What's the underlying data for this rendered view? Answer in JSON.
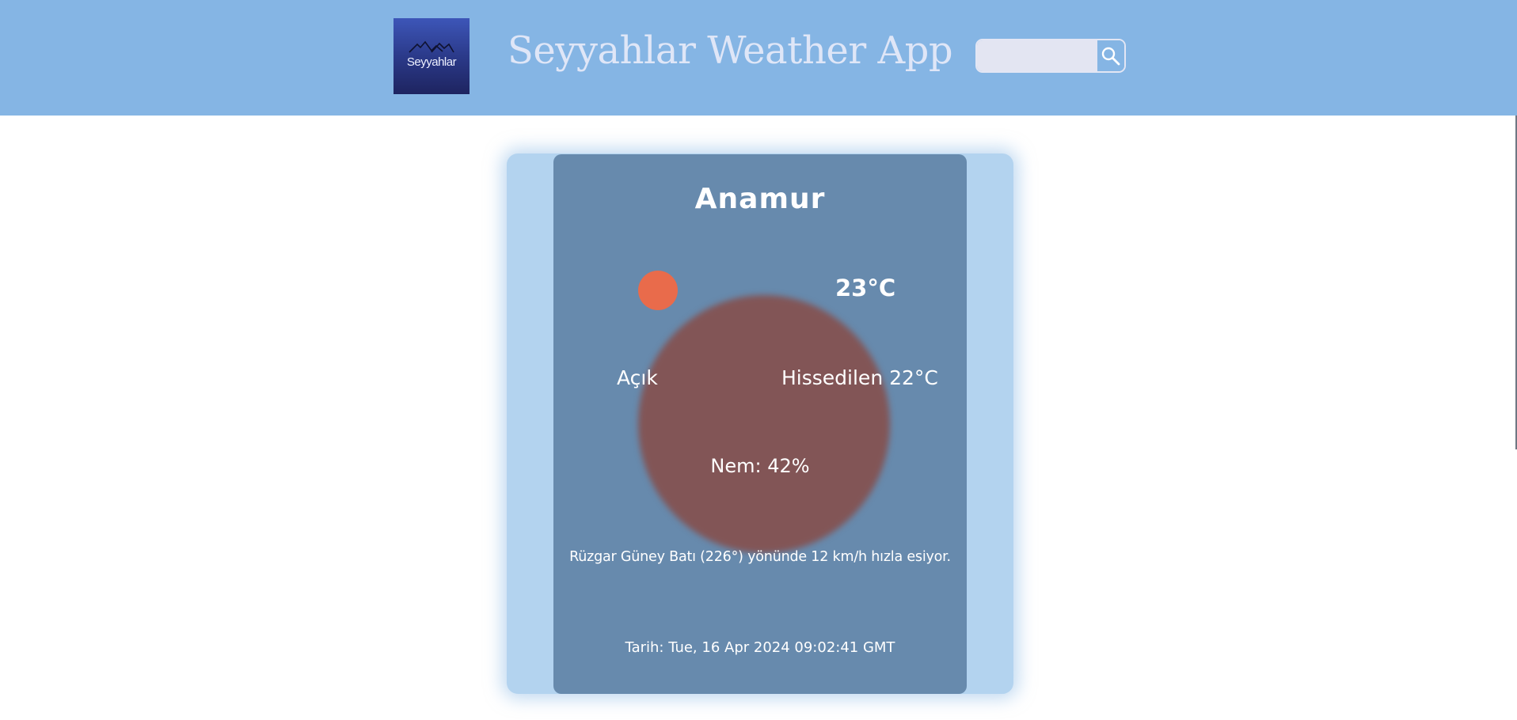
{
  "header": {
    "logo_text": "Seyyahlar",
    "title": "Seyyahlar Weather App",
    "search": {
      "value": "",
      "placeholder": ""
    },
    "search_icon": "search-icon"
  },
  "weather": {
    "city": "Anamur",
    "condition_icon": "sun-icon",
    "temperature": "23°C",
    "condition": "Açık",
    "feels_like": "Hissedilen 22°C",
    "humidity": "Nem: 42%",
    "wind": "Rüzgar Güney Batı (226°) yönünde 12 km/h hızla esiyor.",
    "date": "Tarih: Tue, 16 Apr 2024 09:02:41 GMT"
  },
  "colors": {
    "header_bg": "#85b5e4",
    "card_bg": "#678aad",
    "card_outer": "#b3d3ef",
    "sun": "#e96b4b",
    "glow": "#825556"
  }
}
